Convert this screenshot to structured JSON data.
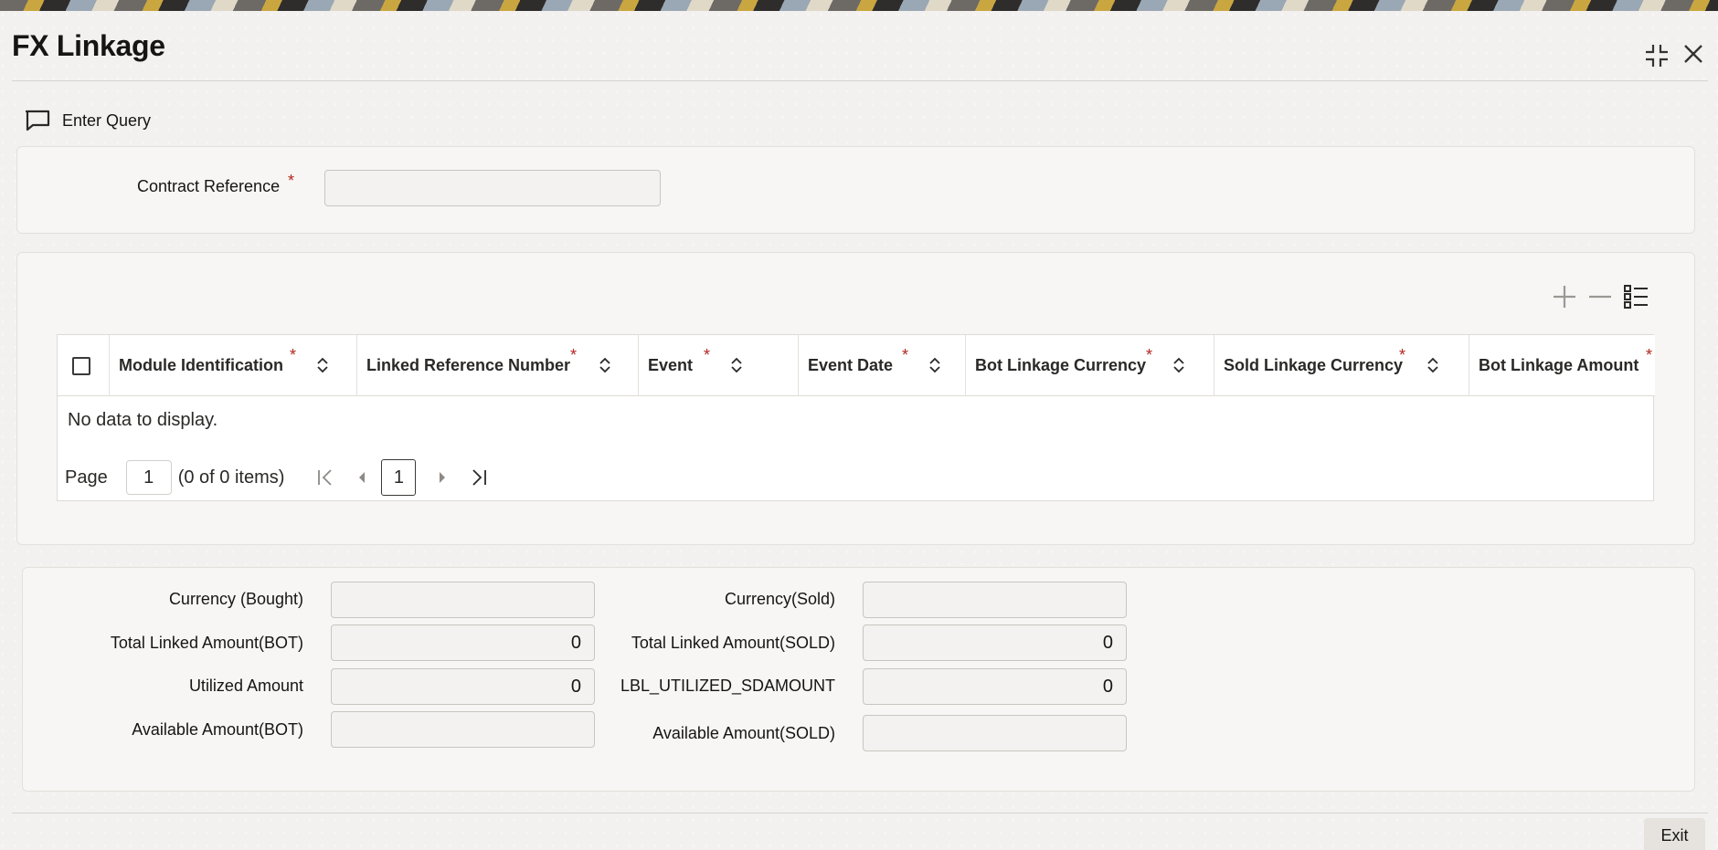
{
  "window": {
    "title": "FX Linkage"
  },
  "toolbar": {
    "enter_query_label": "Enter Query"
  },
  "header_form": {
    "contract_reference_label": "Contract Reference",
    "contract_reference_value": "",
    "required_mark": "*"
  },
  "grid": {
    "columns": [
      {
        "label": "Module Identification",
        "required": "*"
      },
      {
        "label": "Linked Reference Number",
        "required": "*"
      },
      {
        "label": "Event",
        "required": "*"
      },
      {
        "label": "Event Date",
        "required": "*"
      },
      {
        "label": "Bot Linkage Currency",
        "required": "*"
      },
      {
        "label": "Sold Linkage Currency",
        "required": "*"
      },
      {
        "label": "Bot Linkage Amount",
        "required": "*"
      }
    ],
    "empty_message": "No data to display.",
    "pager": {
      "page_label": "Page",
      "page_value": "1",
      "items_text": "(0 of 0 items)",
      "current_page": "1"
    }
  },
  "summary": {
    "currency_bought_label": "Currency (Bought)",
    "currency_bought_value": "",
    "currency_sold_label": "Currency(Sold)",
    "currency_sold_value": "",
    "total_linked_bot_label": "Total Linked Amount(BOT)",
    "total_linked_bot_value": "0",
    "total_linked_sold_label": "Total Linked Amount(SOLD)",
    "total_linked_sold_value": "0",
    "utilized_amount_label": "Utilized Amount",
    "utilized_amount_value": "0",
    "utilized_sd_label": "LBL_UTILIZED_SDAMOUNT",
    "utilized_sd_value": "0",
    "available_bot_label": "Available Amount(BOT)",
    "available_bot_value": "",
    "available_sold_label": "Available Amount(SOLD)",
    "available_sold_value": ""
  },
  "footer": {
    "exit_label": "Exit"
  },
  "colors": {
    "required": "#b3261e",
    "panel_bg": "#f7f6f4",
    "page_bg": "#f3f1ef"
  }
}
